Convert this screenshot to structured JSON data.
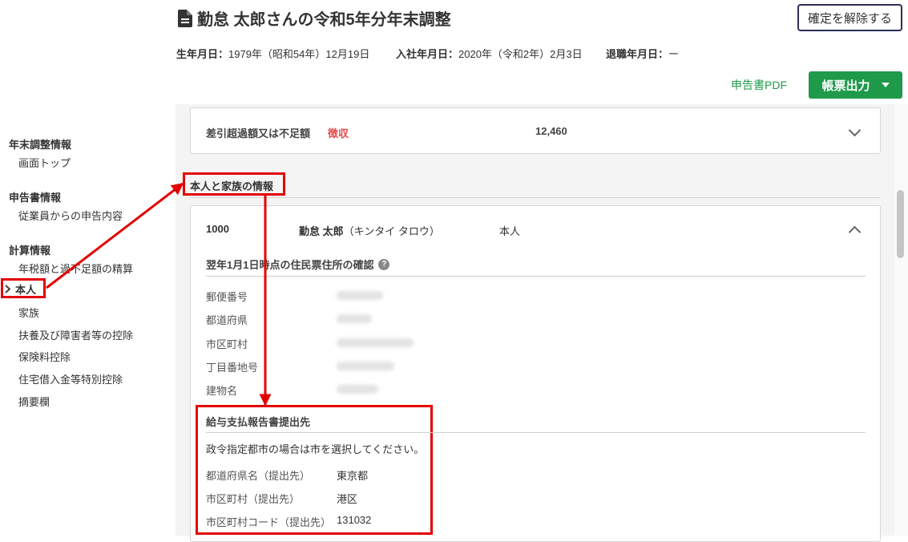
{
  "header": {
    "title": "勤怠 太郎さんの令和5年分年末調整",
    "unconfirm_button": "確定を解除する",
    "birth_label": "生年月日：",
    "birth_value": "1979年（昭和54年）12月19日",
    "join_label": "入社年月日：",
    "join_value": "2020年（令和2年）2月3日",
    "retire_label": "退職年月日：",
    "retire_value": "ー",
    "pdf_link": "申告書PDF",
    "export_button": "帳票出力"
  },
  "sidebar": {
    "groups": [
      {
        "title": "年末調整情報",
        "items": [
          "画面トップ"
        ]
      },
      {
        "title": "申告書情報",
        "items": [
          "従業員からの申告内容"
        ]
      },
      {
        "title": "計算情報",
        "items": [
          "年税額と過不足額の精算",
          "本人",
          "家族",
          "扶養及び障害者等の控除",
          "保険料控除",
          "住宅借入金等特別控除",
          "摘要欄"
        ]
      }
    ],
    "active_item": "本人"
  },
  "summary": {
    "label": "差引超過額又は不足額",
    "badge": "徴収",
    "value": "12,460"
  },
  "section_title": "本人と家族の情報",
  "person": {
    "code": "1000",
    "name": "勤怠 太郎",
    "kana": "（キンタイ タロウ）",
    "relation": "本人"
  },
  "address_section": {
    "title": "翌年1月1日時点の住民票住所の確認",
    "fields": [
      "郵便番号",
      "都道府県",
      "市区町村",
      "丁目番地号",
      "建物名"
    ]
  },
  "report_section": {
    "title": "給与支払報告書提出先",
    "note": "政令指定都市の場合は市を選択してください。",
    "fields": [
      {
        "label": "都道府県名（提出先）",
        "value": "東京都"
      },
      {
        "label": "市区町村（提出先）",
        "value": "港区"
      },
      {
        "label": "市区町村コード（提出先）",
        "value": "131032"
      }
    ]
  },
  "colors": {
    "accent_green": "#1e9a4a",
    "highlight_red": "#e30000",
    "warning_red": "#e34b4b"
  }
}
